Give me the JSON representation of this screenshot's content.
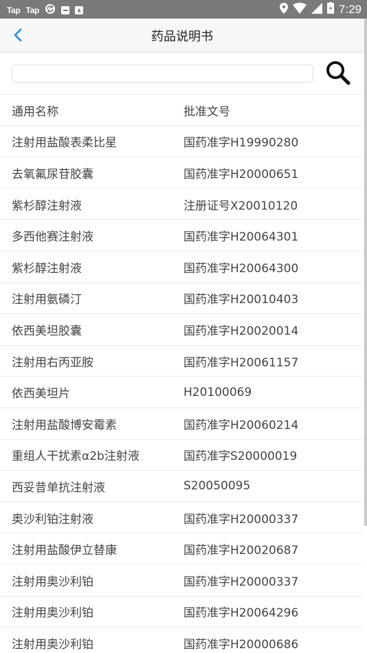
{
  "status_bar": {
    "left_icons": [
      "Tap",
      "Tap"
    ],
    "time": "7:29"
  },
  "app_bar": {
    "title": "药品说明书"
  },
  "search": {
    "value": "",
    "placeholder": ""
  },
  "table": {
    "headers": [
      "通用名称",
      "批准文号"
    ],
    "rows": [
      [
        "注射用盐酸表柔比星",
        "国药准字H19990280"
      ],
      [
        "去氧氟尿苷胶囊",
        "国药准字H20000651"
      ],
      [
        "紫杉醇注射液",
        "注册证号X20010120"
      ],
      [
        "多西他赛注射液",
        "国药准字H20064301"
      ],
      [
        "紫杉醇注射液",
        "国药准字H20064300"
      ],
      [
        "注射用氨磷汀",
        "国药准字H20010403"
      ],
      [
        "依西美坦胶囊",
        "国药准字H20020014"
      ],
      [
        "注射用右丙亚胺",
        "国药准字H20061157"
      ],
      [
        "依西美坦片",
        "H20100069"
      ],
      [
        "注射用盐酸博安霉素",
        "国药准字H20060214"
      ],
      [
        "重组人干扰素α2b注射液",
        "国药准字S20000019"
      ],
      [
        "西妥昔单抗注射液",
        "S20050095"
      ],
      [
        "奥沙利铂注射液",
        "国药准字H20000337"
      ],
      [
        "注射用盐酸伊立替康",
        "国药准字H20020687"
      ],
      [
        "注射用奥沙利铂",
        "国药准字H20000337"
      ],
      [
        "注射用奥沙利铂",
        "国药准字H20064296"
      ],
      [
        "注射用奥沙利铂",
        "国药准字H20000686"
      ]
    ]
  },
  "icons": {
    "back": "chevron-left-icon",
    "search": "search-icon"
  },
  "colors": {
    "accent": "#1e88e5",
    "status_bar": "#7a7a7a"
  }
}
